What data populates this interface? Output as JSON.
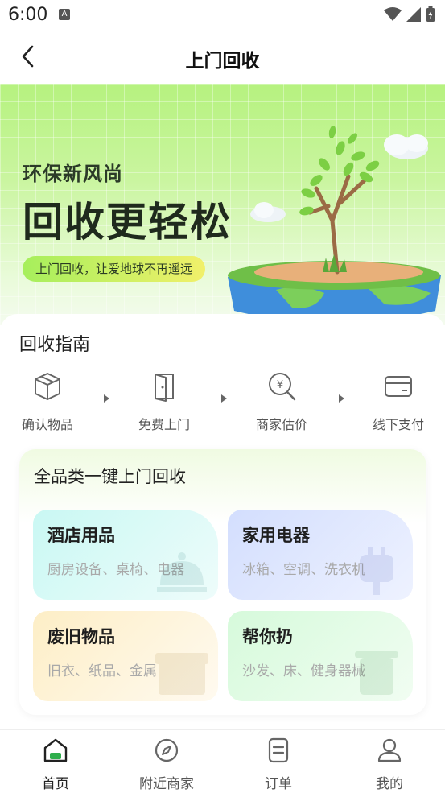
{
  "status": {
    "time": "6:00"
  },
  "nav": {
    "title": "上门回收"
  },
  "banner": {
    "subtitle": "环保新风尚",
    "headline": "回收更轻松",
    "tagline": "上门回收，让爱地球不再遥远"
  },
  "guide": {
    "title": "回收指南",
    "steps": [
      {
        "label": "确认物品",
        "icon": "box-icon"
      },
      {
        "label": "免费上门",
        "icon": "door-icon"
      },
      {
        "label": "商家估价",
        "icon": "yen-search-icon"
      },
      {
        "label": "线下支付",
        "icon": "card-icon"
      }
    ]
  },
  "categories": {
    "title": "全品类一键上门回收",
    "items": [
      {
        "name": "酒店用品",
        "desc": "厨房设备、桌椅、电器",
        "color": "#d6fbf6"
      },
      {
        "name": "家用电器",
        "desc": "冰箱、空调、洗衣机",
        "color": "#dce6ff"
      },
      {
        "name": "废旧物品",
        "desc": "旧衣、纸品、金属",
        "color": "#fdf1cf"
      },
      {
        "name": "帮你扔",
        "desc": "沙发、床、健身器械",
        "color": "#dcfbe0"
      }
    ]
  },
  "tabs": [
    {
      "label": "首页",
      "icon": "home-icon",
      "active": true
    },
    {
      "label": "附近商家",
      "icon": "compass-icon",
      "active": false
    },
    {
      "label": "订单",
      "icon": "order-icon",
      "active": false
    },
    {
      "label": "我的",
      "icon": "user-icon",
      "active": false
    }
  ],
  "colors": {
    "accent": "#8be24a",
    "tab_active": "#2fae4c"
  }
}
